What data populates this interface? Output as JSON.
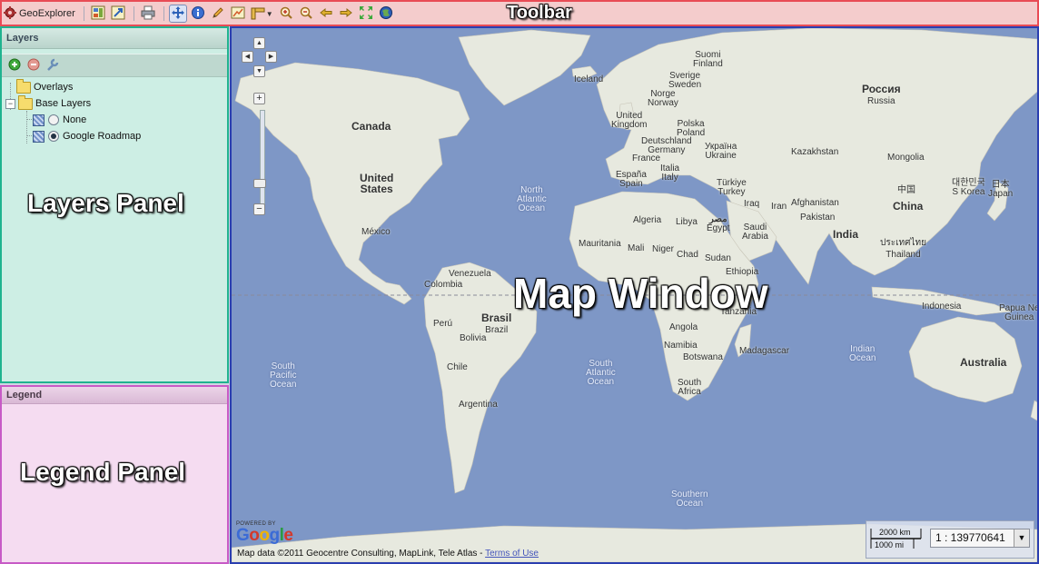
{
  "toolbar": {
    "app_name": "GeoExplorer",
    "label": "Toolbar",
    "buttons": [
      {
        "name": "layer-manager-button",
        "icon": "layer-manager-icon"
      },
      {
        "name": "export-map-button",
        "icon": "export-map-icon"
      },
      {
        "name": "print-button",
        "icon": "printer-icon"
      },
      {
        "name": "pan-button",
        "icon": "pan-icon",
        "pressed": true
      },
      {
        "name": "info-button",
        "icon": "info-icon"
      },
      {
        "name": "edit-feature-button",
        "icon": "pencil-icon"
      },
      {
        "name": "query-button",
        "icon": "query-icon"
      },
      {
        "name": "measure-button",
        "icon": "ruler-icon",
        "dropdown": true
      },
      {
        "name": "zoom-in-button",
        "icon": "zoom-in-icon"
      },
      {
        "name": "zoom-out-button",
        "icon": "zoom-out-icon"
      },
      {
        "name": "previous-extent-button",
        "icon": "arrow-left-icon"
      },
      {
        "name": "next-extent-button",
        "icon": "arrow-right-icon"
      },
      {
        "name": "zoom-max-extent-button",
        "icon": "expand-icon"
      },
      {
        "name": "google-earth-button",
        "icon": "globe-icon"
      }
    ]
  },
  "layers_panel": {
    "title": "Layers",
    "label": "Layers Panel",
    "tools": [
      "add-layer-icon",
      "remove-layer-icon",
      "layer-properties-icon"
    ],
    "tree": {
      "overlays": "Overlays",
      "base_layers": "Base Layers",
      "layers": [
        {
          "label": "None",
          "selected": false
        },
        {
          "label": "Google Roadmap",
          "selected": true
        }
      ]
    }
  },
  "legend_panel": {
    "title": "Legend",
    "label": "Legend Panel"
  },
  "map": {
    "label": "Map Window",
    "attribution": "Map data ©2011 Geocentre Consulting, MapLink, Tele Atlas - ",
    "terms_link": "Terms of Use",
    "powered_by": "POWERED BY",
    "google_logo": "Google",
    "scale_km": "2000 km",
    "scale_mi": "1000 mi",
    "scale_value": "1 : 139770641",
    "labels": {
      "suomi": "Suomi",
      "finland": "Finland",
      "iceland": "Iceland",
      "sverige": "Sverige",
      "sweden": "Sweden",
      "norge": "Norge",
      "norway": "Norway",
      "russia": "Россия",
      "russia_en": "Russia",
      "canada": "Canada",
      "united_kingdom_1": "United",
      "united_kingdom_2": "Kingdom",
      "polska": "Polska",
      "poland": "Poland",
      "deutschland": "Deutschland",
      "germany": "Germany",
      "ukraine_ua": "Україна",
      "ukraine": "Ukraine",
      "kazakhstan": "Kazakhstan",
      "france": "France",
      "mongolia": "Mongolia",
      "espana": "España",
      "spain": "Spain",
      "italia": "Italia",
      "italy": "Italy",
      "turkiye": "Türkiye",
      "turkey": "Turkey",
      "us_1": "United",
      "us_2": "States",
      "north_atlantic_1": "North",
      "north_atlantic_2": "Atlantic",
      "north_atlantic_3": "Ocean",
      "korea_ko": "대한민국",
      "korea": "S Korea",
      "japan_ja": "日本",
      "japan": "Japan",
      "china_zh": "中国",
      "china": "China",
      "afghanistan": "Afghanistan",
      "iraq": "Iraq",
      "iran": "Iran",
      "pakistan": "Pakistan",
      "algeria": "Algeria",
      "libya": "Libya",
      "egypt_ar": "مصر",
      "egypt": "Egypt",
      "mexico": "México",
      "saudi_1": "Saudi",
      "saudi_2": "Arabia",
      "india": "India",
      "thailand_th": "ประเทศไทย",
      "thailand": "Thailand",
      "mauritania": "Mauritania",
      "mali": "Mali",
      "niger": "Niger",
      "chad": "Chad",
      "sudan": "Sudan",
      "venezuela": "Venezuela",
      "ethiopia": "Ethiopia",
      "colombia": "Colombia",
      "tanzania": "Tanzania",
      "indonesia": "Indonesia",
      "papua_1": "Papua Ne",
      "papua_2": "Guinea",
      "brasil": "Brasil",
      "brazil": "Brazil",
      "peru": "Perú",
      "angola": "Angola",
      "bolivia": "Bolivia",
      "namibia": "Namibia",
      "madagascar": "Madagascar",
      "botswana": "Botswana",
      "indian_ocean_1": "Indian",
      "indian_ocean_2": "Ocean",
      "south_pacific_1": "South",
      "south_pacific_2": "Pacific",
      "south_pacific_3": "Ocean",
      "chile": "Chile",
      "south_atlantic_1": "South",
      "south_atlantic_2": "Atlantic",
      "south_atlantic_3": "Ocean",
      "australia": "Australia",
      "south_africa_1": "South",
      "south_africa_2": "Africa",
      "argentina": "Argentina",
      "southern_ocean_1": "Southern",
      "southern_ocean_2": "Ocean"
    }
  },
  "colors": {
    "ocean": "#7e97c6",
    "land": "#e7e9df",
    "toolbar_border": "#e84b55",
    "layers_border": "#1fb38f",
    "legend_border": "#c75ac6",
    "map_border": "#2b3fb0"
  }
}
